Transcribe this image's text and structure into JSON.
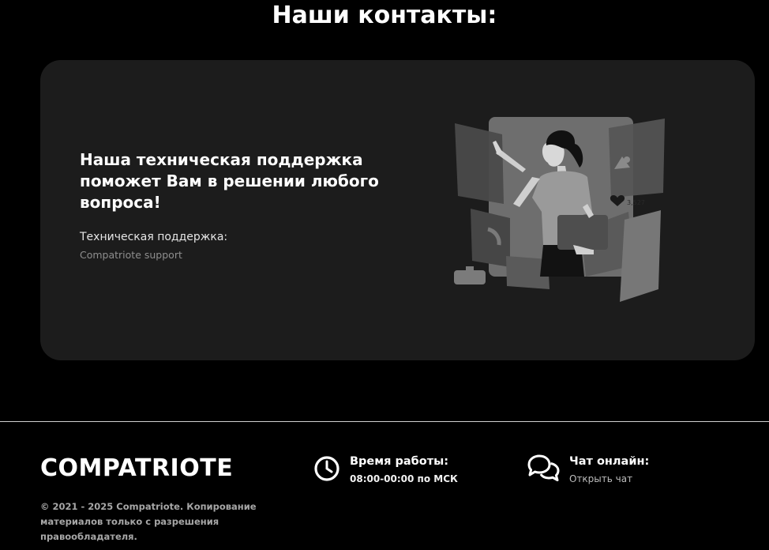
{
  "page": {
    "title": "Наши контакты:"
  },
  "support_card": {
    "headline": "Наша техническая поддержка поможет Вам в решении любого вопроса!",
    "label": "Техническая поддержка:",
    "link": "Compatriote support",
    "illustration": {
      "likes": "3,527"
    }
  },
  "footer": {
    "logo": "COMPATRIOTE",
    "copyright": "© 2021 - 2025 Compatriote. Копирование материалов только с разрешения правообладателя.",
    "hours": {
      "title": "Время работы:",
      "value": "08:00-00:00 по МСК",
      "icon": "clock-icon"
    },
    "chat": {
      "title": "Чат онлайн:",
      "action": "Открыть чат",
      "icon": "chat-bubbles-icon"
    }
  },
  "colors": {
    "background": "#000000",
    "card": "#1c1c1c",
    "muted_text": "#8e8e8e"
  }
}
